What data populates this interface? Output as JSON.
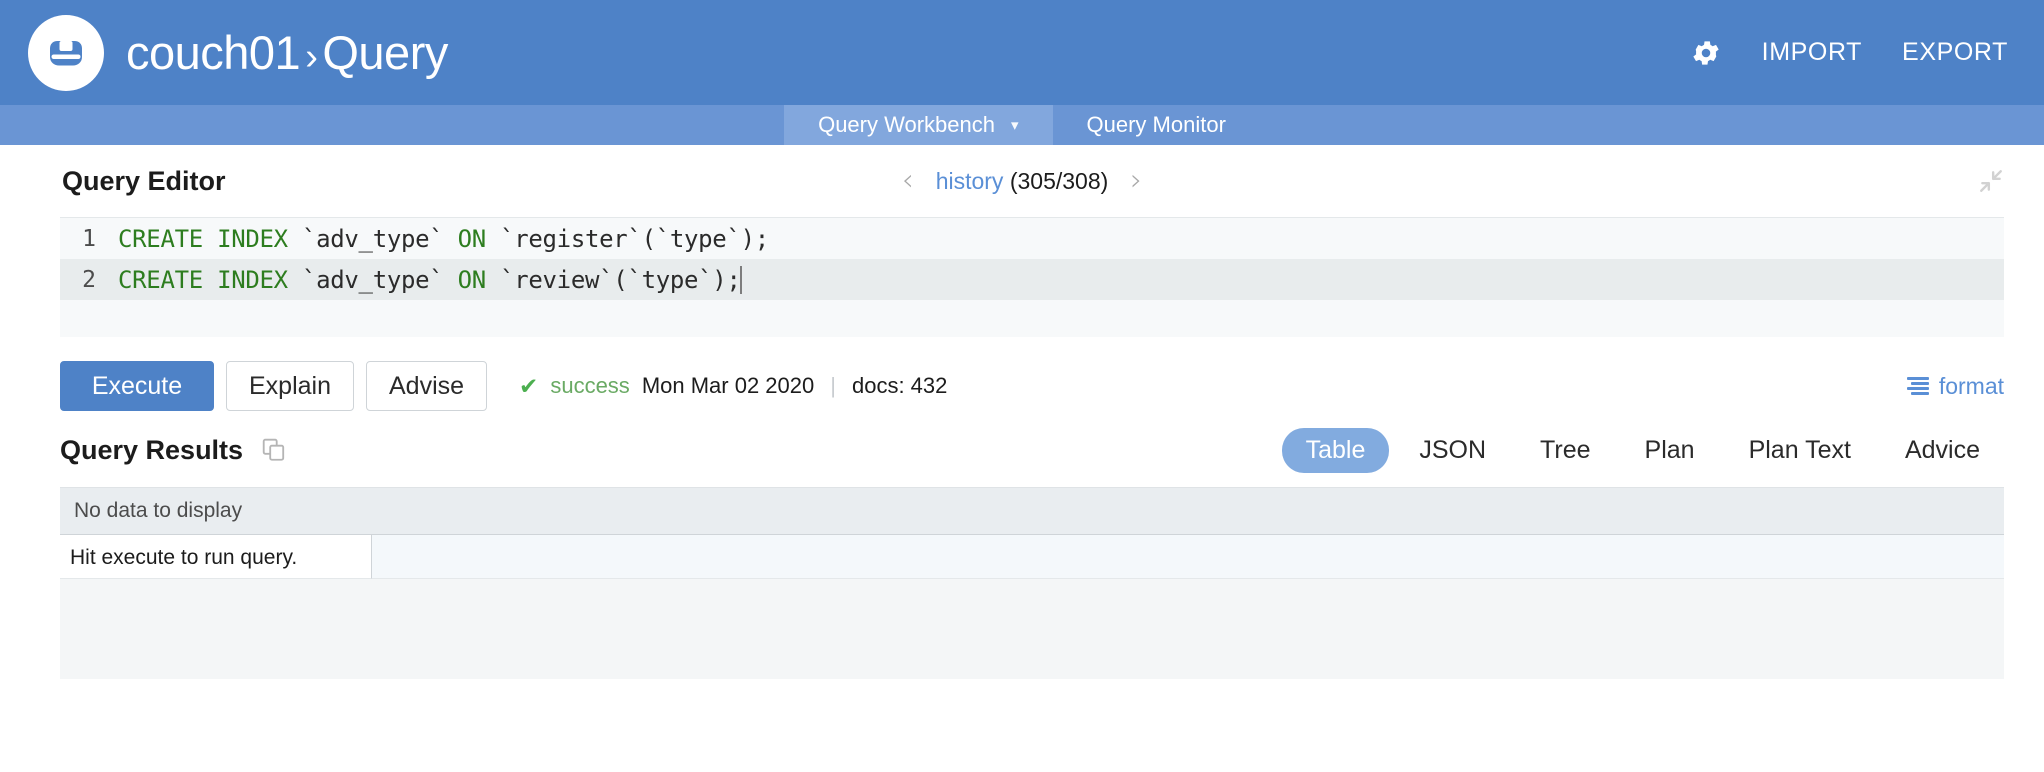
{
  "header": {
    "logo_icon": "couchbase-logo-icon",
    "bucket": "couch01",
    "separator": "›",
    "page": "Query",
    "gear_icon": "gear-icon",
    "import_label": "IMPORT",
    "export_label": "EXPORT",
    "background_color": "#4e82c7"
  },
  "tabs": [
    {
      "label": "Query Workbench",
      "active": true,
      "caret_icon": "chevron-down-icon"
    },
    {
      "label": "Query Monitor",
      "active": false
    }
  ],
  "editor_section": {
    "title": "Query Editor",
    "history": {
      "prev_icon": "chevron-left-icon",
      "next_icon": "chevron-right-icon",
      "link_label": "history",
      "counter": "(305/308)",
      "current": 305,
      "total": 308
    },
    "collapse_icon": "collapse-icon",
    "lines": [
      {
        "number": "1",
        "active": false,
        "tokens": [
          {
            "t": "CREATE",
            "k": true
          },
          {
            "t": " ",
            "k": false
          },
          {
            "t": "INDEX",
            "k": true
          },
          {
            "t": " `adv_type` ",
            "k": false
          },
          {
            "t": "ON",
            "k": true
          },
          {
            "t": " `register`(`type`);",
            "k": false
          }
        ]
      },
      {
        "number": "2",
        "active": true,
        "tokens": [
          {
            "t": "CREATE",
            "k": true
          },
          {
            "t": " ",
            "k": false
          },
          {
            "t": "INDEX",
            "k": true
          },
          {
            "t": " `adv_type` ",
            "k": false
          },
          {
            "t": "ON",
            "k": true
          },
          {
            "t": " `review`(`type`);",
            "k": false
          }
        ]
      }
    ],
    "keyword_color": "#2d7d1f"
  },
  "actions": {
    "execute_label": "Execute",
    "explain_label": "Explain",
    "advise_label": "Advise",
    "status": {
      "check_icon": "check-icon",
      "state": "success",
      "state_color": "#6aaa64",
      "timestamp": "Mon Mar 02 2020",
      "separator": "|",
      "docs": "docs: 432"
    },
    "format": {
      "icon": "format-lines-icon",
      "label": "format",
      "color": "#5a8fd6"
    }
  },
  "results_section": {
    "title": "Query Results",
    "copy_icon": "copy-icon",
    "tabs": [
      {
        "label": "Table",
        "active": true
      },
      {
        "label": "JSON",
        "active": false
      },
      {
        "label": "Tree",
        "active": false
      },
      {
        "label": "Plan",
        "active": false
      },
      {
        "label": "Plan Text",
        "active": false
      },
      {
        "label": "Advice",
        "active": false
      }
    ],
    "no_data_label": "No data to display",
    "cell_text": "Hit execute to run query."
  }
}
